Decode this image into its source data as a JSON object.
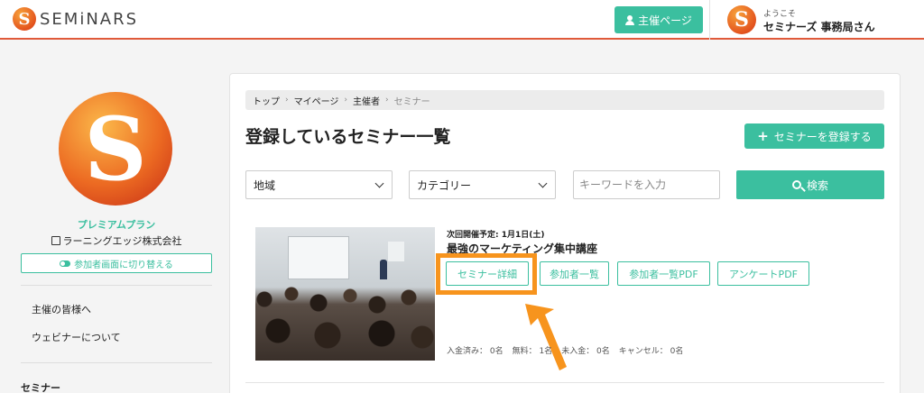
{
  "header": {
    "logo_letter": "S",
    "logo_text": "SEMiNARS",
    "host_page_label": "主催ページ",
    "welcome_small": "ようこそ",
    "welcome_name": "セミナーズ 事務局さん",
    "avatar_letter": "S"
  },
  "sidebar": {
    "avatar_letter": "S",
    "plan": "プレミアムプラン",
    "company": "ラーニングエッジ株式会社",
    "switch_label": "参加者画面に切り替える",
    "links": [
      "主催の皆様へ",
      "ウェビナーについて"
    ],
    "section_title": "セミナー"
  },
  "breadcrumb": {
    "items": [
      "トップ",
      "マイページ",
      "主催者",
      "セミナー"
    ]
  },
  "main": {
    "title": "登録しているセミナー一覧",
    "register_label": "セミナーを登録する",
    "filters": {
      "region": "地域",
      "category": "カテゴリー",
      "keyword_placeholder": "キーワードを入力",
      "search_label": "検索"
    },
    "seminar": {
      "next_date": "次回開催予定: 1月1日(土)",
      "title": "最強のマーケティング集中講座",
      "buttons": [
        "セミナー詳細",
        "参加者一覧",
        "参加者一覧PDF",
        "アンケートPDF"
      ],
      "counts": [
        "入金済み： 0名",
        "無料： 1名",
        "未入金： 0名",
        "キャンセル： 0名"
      ]
    }
  },
  "colors": {
    "accent": "#3bbf9f",
    "highlight": "#f7941d",
    "brand": "#e4541e"
  }
}
